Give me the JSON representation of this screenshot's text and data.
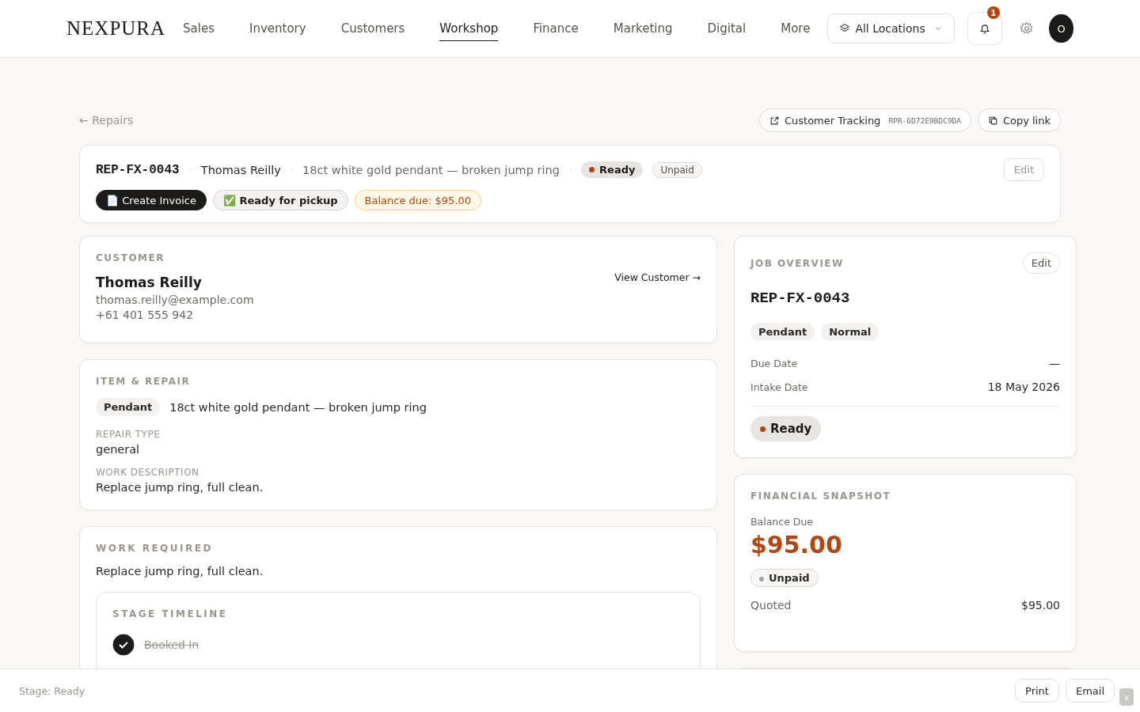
{
  "header": {
    "logo": "NEXPURA",
    "nav": [
      {
        "label": "Sales",
        "selected": false
      },
      {
        "label": "Inventory",
        "selected": false
      },
      {
        "label": "Customers",
        "selected": false
      },
      {
        "label": "Workshop",
        "selected": true
      },
      {
        "label": "Finance",
        "selected": false
      },
      {
        "label": "Marketing",
        "selected": false
      },
      {
        "label": "Digital",
        "selected": false
      },
      {
        "label": "More",
        "selected": false
      }
    ],
    "location": "All Locations",
    "notifications": "1",
    "avatar": "O"
  },
  "back_link": "← Repairs",
  "tracking": {
    "label": "Customer Tracking",
    "code": "RPR-6D72E9BDC9DA",
    "copy": "Copy link"
  },
  "summary": {
    "separator": "·",
    "job_number": "REP-FX-0043",
    "customer": "Thomas Reilly",
    "item": "18ct white gold pendant — broken jump ring",
    "status": "Ready",
    "payment": "Unpaid",
    "edit": "Edit",
    "actions": [
      {
        "kind": "dark",
        "label": "📄 Create Invoice"
      },
      {
        "kind": "light",
        "label": "✅ Ready for pickup"
      },
      {
        "kind": "warning",
        "label": "Balance due: $95.00"
      }
    ]
  },
  "customer": {
    "heading": "CUSTOMER",
    "name": "Thomas Reilly",
    "email": "thomas.reilly@example.com",
    "phone": "+61 401 555 942",
    "link": "View Customer →"
  },
  "item_repair": {
    "heading": "ITEM & REPAIR",
    "tag": "Pendant",
    "description": "18ct white gold pendant — broken jump ring",
    "fields": [
      {
        "label": "REPAIR TYPE",
        "value": "general"
      },
      {
        "label": "WORK DESCRIPTION",
        "value": "Replace jump ring, full clean."
      }
    ]
  },
  "work_required": {
    "heading": "WORK REQUIRED",
    "text": "Replace jump ring, full clean.",
    "timeline": {
      "heading": "STAGE TIMELINE",
      "stages": [
        {
          "label": "Booked In",
          "done": true
        }
      ]
    }
  },
  "job_overview": {
    "heading": "JOB OVERVIEW",
    "edit": "Edit",
    "job_number": "REP-FX-0043",
    "tags": [
      "Pendant",
      "Normal"
    ],
    "rows": [
      {
        "label": "Due Date",
        "value": "—"
      },
      {
        "label": "Intake Date",
        "value": "18 May 2026"
      }
    ],
    "status": "Ready"
  },
  "financial": {
    "heading": "FINANCIAL SNAPSHOT",
    "balance_label": "Balance Due",
    "balance": "$95.00",
    "payment": "Unpaid",
    "rows": [
      {
        "label": "Quoted",
        "value": "$95.00"
      }
    ]
  },
  "footer": {
    "stage": "Stage: Ready",
    "buttons": [
      "Print",
      "Email"
    ],
    "scroll": "∨"
  }
}
